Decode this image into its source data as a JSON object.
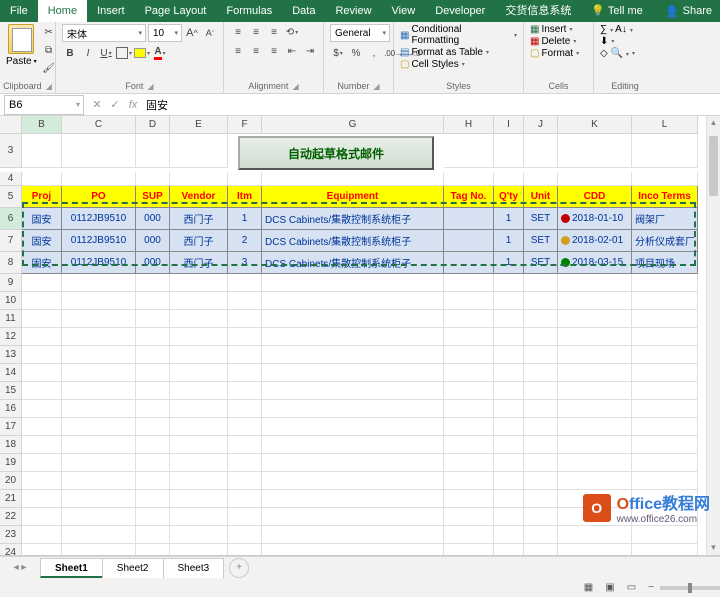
{
  "tabs": {
    "file": "File",
    "home": "Home",
    "insert": "Insert",
    "pagelayout": "Page Layout",
    "formulas": "Formulas",
    "data": "Data",
    "review": "Review",
    "view": "View",
    "developer": "Developer",
    "custom": "交货信息系统",
    "tellme": "Tell me"
  },
  "titleright": {
    "share": "Share"
  },
  "ribbon": {
    "clipboard": {
      "paste": "Paste",
      "label": "Clipboard"
    },
    "font": {
      "name": "宋体",
      "size": "10",
      "label": "Font",
      "bold": "B",
      "italic": "I",
      "underline": "U",
      "increase": "A",
      "decrease": "A"
    },
    "alignment": {
      "label": "Alignment"
    },
    "number": {
      "format": "General",
      "label": "Number"
    },
    "styles": {
      "cond": "Conditional Formatting",
      "table": "Format as Table",
      "cell": "Cell Styles",
      "label": "Styles"
    },
    "cells": {
      "insert": "Insert",
      "delete": "Delete",
      "format": "Format",
      "label": "Cells"
    },
    "editing": {
      "label": "Editing"
    }
  },
  "namebox": "B6",
  "formula": "固安",
  "cols": [
    "B",
    "C",
    "D",
    "E",
    "F",
    "G",
    "H",
    "I",
    "J",
    "K",
    "L"
  ],
  "button_label": "自动起草格式邮件",
  "headers": {
    "proj": "Proj",
    "po": "PO",
    "sup": "SUP",
    "vendor": "Vendor",
    "itm": "Itm",
    "equipment": "Equipment",
    "tag": "Tag No.",
    "qty": "Q'ty",
    "unit": "Unit",
    "cdd": "CDD",
    "inco": "Inco Terms"
  },
  "rows": [
    {
      "proj": "固安",
      "po": "0112JB9510",
      "sup": "000",
      "vendor": "西门子",
      "itm": "1",
      "equipment": "DCS Cabinets/集散控制系统柜子",
      "tag": "",
      "qty": "1",
      "unit": "SET",
      "cdd": "2018-01-10",
      "dot": "r",
      "inco": "阀架厂"
    },
    {
      "proj": "固安",
      "po": "0112JB9510",
      "sup": "000",
      "vendor": "西门子",
      "itm": "2",
      "equipment": "DCS Cabinets/集散控制系统柜子",
      "tag": "",
      "qty": "1",
      "unit": "SET",
      "cdd": "2018-02-01",
      "dot": "y",
      "inco": "分析仪成套厂"
    },
    {
      "proj": "固安",
      "po": "0112JB9510",
      "sup": "000",
      "vendor": "西门子",
      "itm": "3",
      "equipment": "DCS Cabinets/集散控制系统柜子",
      "tag": "",
      "qty": "1",
      "unit": "SET",
      "cdd": "2018-03-15",
      "dot": "g",
      "inco": "项目现场"
    }
  ],
  "sheets": {
    "s1": "Sheet1",
    "s2": "Sheet2",
    "s3": "Sheet3"
  },
  "status": {
    "ready": ""
  },
  "watermark": {
    "brand": "Office教程网",
    "url": "www.office26.com"
  }
}
